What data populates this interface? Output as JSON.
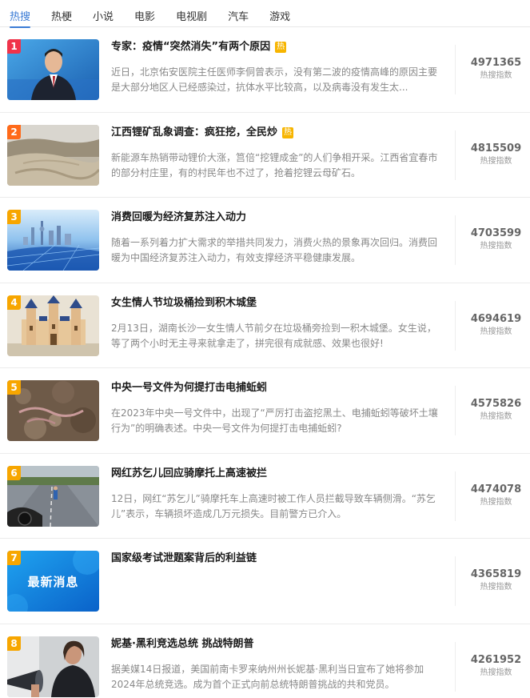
{
  "tabs": [
    {
      "label": "热搜",
      "active": true
    },
    {
      "label": "热梗",
      "active": false
    },
    {
      "label": "小说",
      "active": false
    },
    {
      "label": "电影",
      "active": false
    },
    {
      "label": "电视剧",
      "active": false
    },
    {
      "label": "汽车",
      "active": false
    },
    {
      "label": "游戏",
      "active": false
    }
  ],
  "score_label": "热搜指数",
  "colors": {
    "accent": "#3a7bd5",
    "rank_top1": "#f0334a",
    "rank_top2": "#ff6a1a",
    "rank_other": "#f7a600",
    "hot_badge": "#f7b500"
  },
  "items": [
    {
      "rank": "1",
      "title": "专家：疫情“突然消失”有两个原因",
      "hot": "热",
      "desc": "近日，北京佑安医院主任医师李侗曾表示，没有第二波的疫情高峰的原因主要是大部分地区人已经感染过，抗体水平比较高，以及病毒没有发生太...",
      "score": "4971365",
      "thumb": "man-portrait"
    },
    {
      "rank": "2",
      "title": "江西锂矿乱象调查：疯狂挖，全民炒",
      "hot": "热",
      "desc": "新能源车热销带动锂价大涨，筥倍“挖锂成金”的人们争相开采。江西省宜春市的部分村庄里，有的村民年也不过了，抢着挖锂云母矿石。",
      "score": "4815509",
      "thumb": "mine"
    },
    {
      "rank": "3",
      "title": "消费回暖为经济复苏注入动力",
      "hot": "",
      "desc": "随着一系列着力扩大需求的举措共同发力，消费火热的景象再次回归。消费回暖为中国经济复苏注入动力，有效支撑经济平稳健康发展。",
      "score": "4703599",
      "thumb": "city"
    },
    {
      "rank": "4",
      "title": "女生情人节垃圾桶捡到积木城堡",
      "hot": "",
      "desc": "2月13日，湖南长沙一女生情人节前夕在垃圾桶旁捡到一积木城堡。女生说，等了两个小时无主寻来就拿走了，拼完很有成就感、效果也很好!",
      "score": "4694619",
      "thumb": "castle"
    },
    {
      "rank": "5",
      "title": "中央一号文件为何提打击电捕蚯蚓",
      "hot": "",
      "desc": "在2023年中央一号文件中，出现了“严厉打击盗挖黑土、电捕蚯蚓等破坏土壤行为”的明确表述。中央一号文件为何提打击电捕蚯蚓?",
      "score": "4575826",
      "thumb": "soil"
    },
    {
      "rank": "6",
      "title": "网红苏乞儿回应骑摩托上高速被拦",
      "hot": "",
      "desc": "12日，网红“苏乞儿”骑摩托车上高速时被工作人员拦截导致车辆侧滑。“苏乞儿”表示，车辆损坏造成几万元损失。目前警方已介入。",
      "score": "4474078",
      "thumb": "road"
    },
    {
      "rank": "7",
      "title": "国家级考试泄题案背后的利益链",
      "hot": "",
      "desc": "",
      "score": "4365819",
      "thumb": "news",
      "thumb_text": "最新消息"
    },
    {
      "rank": "8",
      "title": "妮基·黑利竞选总统 挑战特朗普",
      "hot": "",
      "desc": "据美媒14日报道，美国前南卡罗来纳州州长妮基·黑利当日宣布了她将参加2024年总统竞选。成为首个正式向前总统特朗普挑战的共和党员。",
      "score": "4261952",
      "thumb": "speaker"
    }
  ]
}
